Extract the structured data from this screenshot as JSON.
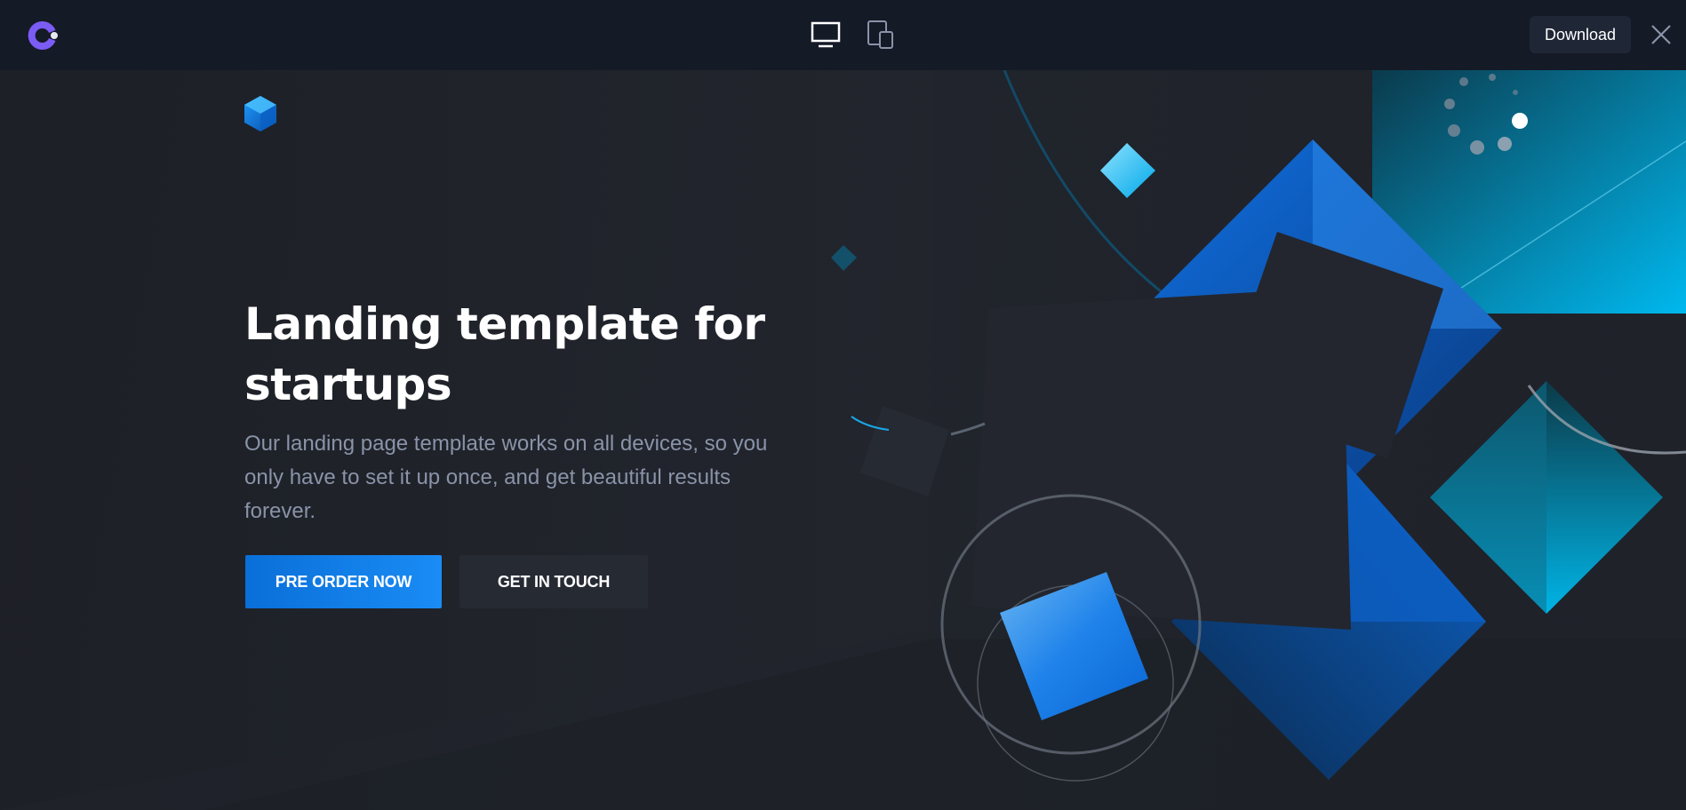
{
  "topbar": {
    "download_label": "Download",
    "icons": [
      "cruip-logo-icon",
      "desktop-icon",
      "mobile-devices-icon",
      "close-icon"
    ]
  },
  "hero": {
    "title": "Landing template for startups",
    "paragraph": "Our landing page template works on all devices, so you only have to set it up once, and get beautiful results forever.",
    "primary_button": "PRE ORDER NOW",
    "secondary_button": "GET IN TOUCH"
  },
  "colors": {
    "topbar_bg": "#141a26",
    "hero_bg": "#1e2128",
    "primary_accent": "#0a6fd8",
    "cyan_accent": "#00b4e6",
    "brand_purple": "#7b5cf5"
  }
}
